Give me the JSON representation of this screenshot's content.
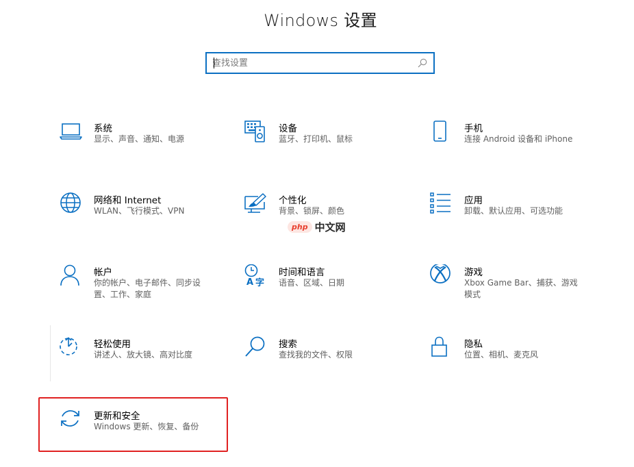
{
  "header": {
    "title": "Windows 设置"
  },
  "search": {
    "placeholder": "查找设置"
  },
  "watermark": {
    "logo": "php",
    "text": "中文网"
  },
  "colors": {
    "accent": "#0a6fc2",
    "highlight": "#e02020"
  },
  "tiles": [
    {
      "name": "系统",
      "desc": "显示、声音、通知、电源",
      "icon": "laptop-icon"
    },
    {
      "name": "设备",
      "desc": "蓝牙、打印机、鼠标",
      "icon": "keyboard-speaker-icon"
    },
    {
      "name": "手机",
      "desc": "连接 Android 设备和 iPhone",
      "icon": "phone-icon"
    },
    {
      "name": "网络和 Internet",
      "desc": "WLAN、飞行模式、VPN",
      "icon": "globe-icon"
    },
    {
      "name": "个性化",
      "desc": "背景、锁屏、颜色",
      "icon": "paint-brush-icon"
    },
    {
      "name": "应用",
      "desc": "卸载、默认应用、可选功能",
      "icon": "app-list-icon"
    },
    {
      "name": "帐户",
      "desc": "你的帐户、电子邮件、同步设置、工作、家庭",
      "icon": "person-icon"
    },
    {
      "name": "时间和语言",
      "desc": "语音、区域、日期",
      "icon": "clock-language-icon"
    },
    {
      "name": "游戏",
      "desc": "Xbox Game Bar、捕获、游戏模式",
      "icon": "xbox-icon"
    },
    {
      "name": "轻松使用",
      "desc": "讲述人、放大镜、高对比度",
      "icon": "ease-of-access-icon"
    },
    {
      "name": "搜索",
      "desc": "查找我的文件、权限",
      "icon": "search-icon"
    },
    {
      "name": "隐私",
      "desc": "位置、相机、麦克风",
      "icon": "lock-icon"
    },
    {
      "name": "更新和安全",
      "desc": "Windows 更新、恢复、备份",
      "icon": "sync-icon"
    }
  ]
}
